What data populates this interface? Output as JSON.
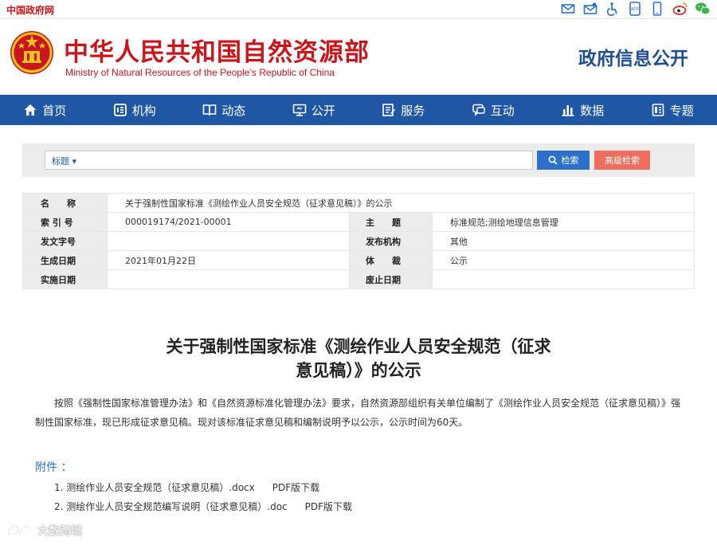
{
  "topbar": {
    "gov_link": "中国政府网",
    "icons": [
      "mail-icon",
      "mail-open-icon",
      "accessibility-icon",
      "app-icon",
      "mobile-icon",
      "weibo-icon",
      "wechat-icon"
    ]
  },
  "header": {
    "title": "中华人民共和国自然资源部",
    "subtitle": "Ministry of Natural Resources of the People’s Republic of China",
    "gov_info": "政府信息公开"
  },
  "nav": {
    "items": [
      {
        "label": "首页",
        "icon": "home-icon"
      },
      {
        "label": "机构",
        "icon": "organization-icon"
      },
      {
        "label": "动态",
        "icon": "book-icon"
      },
      {
        "label": "公开",
        "icon": "monitor-icon"
      },
      {
        "label": "服务",
        "icon": "document-edit-icon"
      },
      {
        "label": "互动",
        "icon": "chat-icon"
      },
      {
        "label": "数据",
        "icon": "bar-chart-icon"
      },
      {
        "label": "专题",
        "icon": "topic-icon"
      }
    ]
  },
  "search": {
    "select_label": "标题 ▾",
    "placeholder": "",
    "search_label": "检索",
    "advanced_label": "高级检索"
  },
  "meta": {
    "name_label": "名　　称",
    "name_value": "关于强制性国家标准《测绘作业人员安全规范（征求意见稿）》的公示",
    "index_label": "索 引 号",
    "index_value": "000019174/2021-00001",
    "subject_label": "主　　题",
    "subject_value": "标准规范;测绘地理信息管理",
    "docno_label": "发文字号",
    "docno_value": "",
    "publisher_label": "发布机构",
    "publisher_value": "其他",
    "date_label": "生成日期",
    "date_value": "2021年01月22日",
    "genre_label": "体　　裁",
    "genre_value": "公示",
    "effective_label": "实施日期",
    "effective_value": "",
    "expire_label": "废止日期",
    "expire_value": ""
  },
  "article": {
    "title_line1": "关于强制性国家标准《测绘作业人员安全规范（征求",
    "title_line2": "意见稿）》的公示",
    "body": "按照《强制性国家标准管理办法》和《自然资源标准化管理办法》要求，自然资源部组织有关单位编制了《测绘作业人员安全规范（征求意见稿）》强制性国家标准，现已形成征求意见稿。现对该标准征求意见稿和编制说明予以公示，公示时间为60天。"
  },
  "attachments": {
    "label": "附件 ：",
    "items": [
      {
        "name": "1. 测绘作业人员安全规范（征求意见稿）.docx",
        "pdf": "PDF版下载"
      },
      {
        "name": "2. 测绘作业人员安全规范编写说明（征求意见稿）.doc",
        "pdf": "PDF版下载"
      }
    ]
  },
  "watermark": "大数跨境"
}
